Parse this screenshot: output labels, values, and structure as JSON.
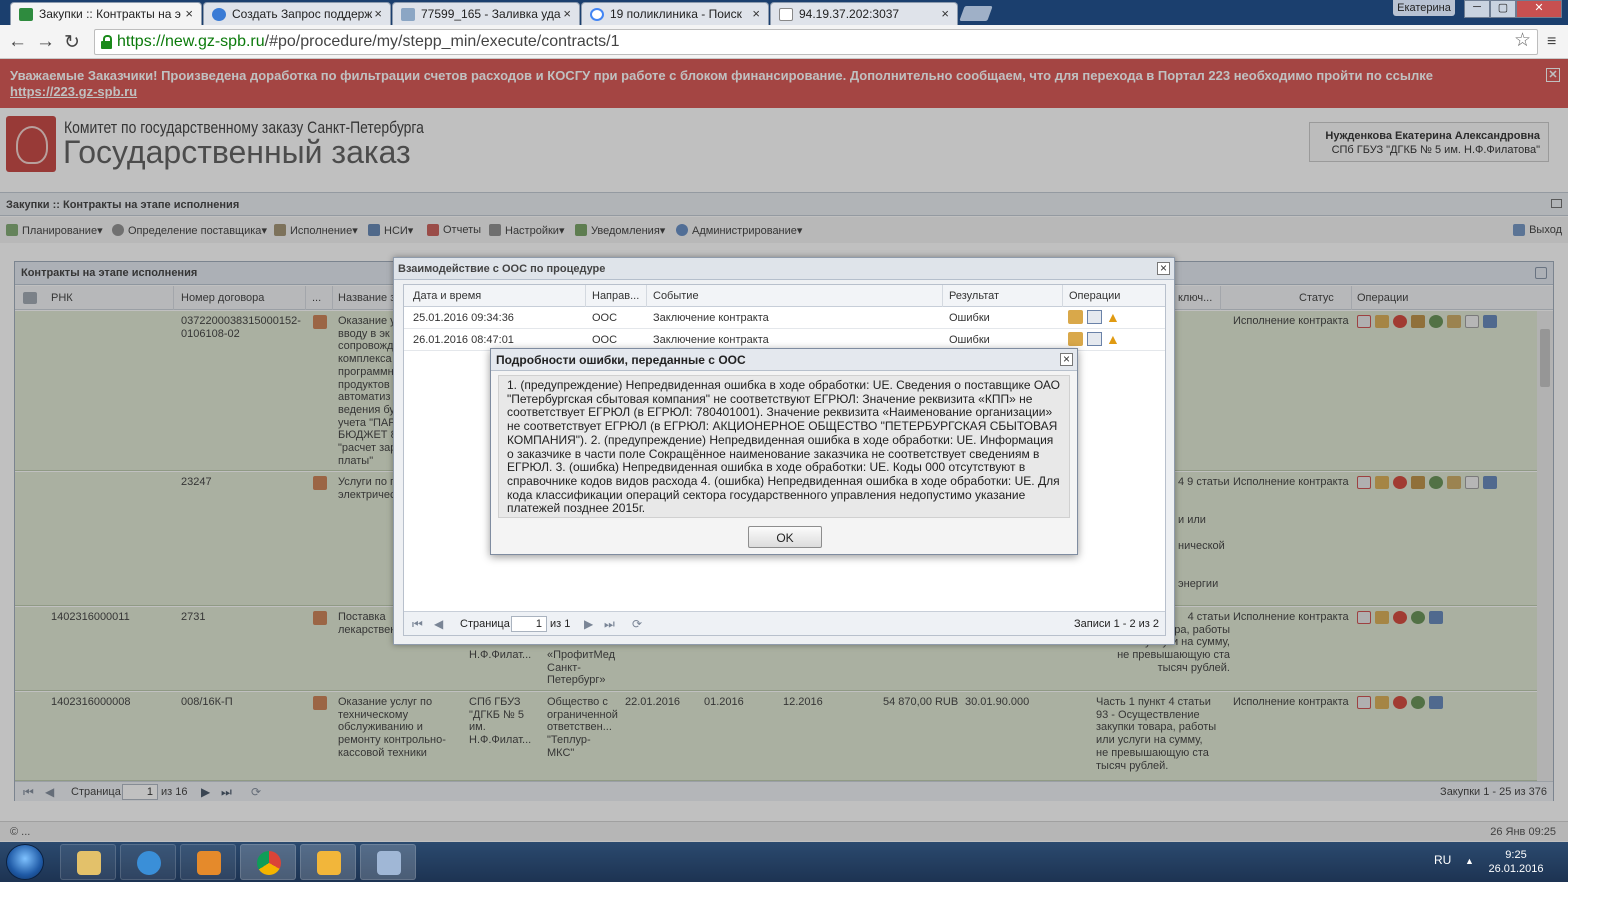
{
  "browser": {
    "tabs": [
      {
        "title": "Закупки :: Контракты на э",
        "active": true
      },
      {
        "title": "Создать Запрос поддерж"
      },
      {
        "title": "77599_165 - Заливка уда"
      },
      {
        "title": "19 поликлиника - Поиск"
      },
      {
        "title": "94.19.37.202:3037"
      }
    ],
    "profile": "Екатерина",
    "url_host": "https://new.gz-spb.ru",
    "url_path": "/#po/procedure/my/stepp_min/execute/contracts/1"
  },
  "banner": {
    "text": "Уважаемые Заказчики! Произведена доработка по фильтрации счетов расходов и КОСГУ при работе с блоком финансирование. Дополнительно сообщаем, что для перехода в Портал 223 необходимо пройти по ссылке",
    "link": "https://223.gz-spb.ru",
    "close": "✕"
  },
  "header": {
    "org_line1": "Комитет по государственному заказу Санкт-Петербурга",
    "org_line2": "Государственный заказ",
    "user_name": "Нужденкова Екатерина Александровна",
    "user_org": "СПб ГБУЗ \"ДГКБ № 5 им. Н.Ф.Филатова\""
  },
  "breadcrumb": "Закупки :: Контракты на этапе исполнения",
  "menu": {
    "items": [
      "Планирование",
      "Определение поставщика",
      "Исполнение",
      "НСИ",
      "Отчеты",
      "Настройки",
      "Уведомления",
      "Администрирование"
    ],
    "exit": "Выход"
  },
  "grid": {
    "title": "Контракты на этапе исполнения",
    "columns": {
      "rnk": "РНК",
      "number": "Номер договора",
      "dots": "...",
      "name": "Название з",
      "basis": "ключ...",
      "status": "Статус",
      "ops": "Операции"
    },
    "rows": [
      {
        "rnk": "",
        "number": "0372200038315000152-0106108-02",
        "name": "Оказание у\nвводу в эк\nсопровожд\nкомплекса\nпрограммн\nпродуктов\nавтоматиз\nведения бу\nучета \"ПАР\nБЮДЖЕТ 8\n\"расчет зар\nплаты\"",
        "basis": "",
        "status": "Исполнение контракта"
      },
      {
        "rnk": "",
        "number": "23247",
        "name": "Услуги по п\nэлектричес",
        "basis": "4 9 статьи\n\n\nи или\n\nнической\n\n\nэнергии",
        "status": "Исполнение контракта"
      },
      {
        "rnk": "1402316000011",
        "number": "2731",
        "name": "Поставка\nлекарствен",
        "customer": "Н.Ф.Филат...",
        "supplier": "«ПрофитМед\nСанкт-\nПетербург»",
        "basis": "4 статьи\nкупки товара, работы\nили услуги на сумму,\nне превышающую ста\nтысяч рублей.",
        "status": "Исполнение контракта"
      },
      {
        "rnk": "1402316000008",
        "number": "008/16К-П",
        "name": "Оказание услуг по\nтехническому\nобслуживанию и\nремонту контрольно-\nкассовой техники",
        "customer": "СПб ГБУЗ\n\"ДГКБ № 5\nим.\nН.Ф.Филат...",
        "supplier": "Общество с\nограниченной\nответствен...\n\"Теплур-\nМКС\"",
        "date": "22.01.2016",
        "start": "01.2016",
        "end": "12.2016",
        "price": "54 870,00 RUB",
        "okpd": "30.01.90.000",
        "basis": "Часть 1 пункт 4 статьи\n93 - Осуществление\nзакупки товара, работы\nили услуги на сумму,\nне превышающую ста\nтысяч рублей.",
        "status": "Исполнение контракта"
      }
    ],
    "pager": {
      "page_label": "Страница",
      "page": "1",
      "of": "из 16",
      "records": "Закупки 1 - 25 из 376"
    }
  },
  "oos_dialog": {
    "title": "Взаимодействие с ООС по процедуре",
    "columns": {
      "datetime": "Дата и время",
      "direction": "Направ...",
      "event": "Событие",
      "result": "Результат",
      "ops": "Операции"
    },
    "rows": [
      {
        "datetime": "25.01.2016 09:34:36",
        "direction": "ООС",
        "event": "Заключение контракта",
        "result": "Ошибки"
      },
      {
        "datetime": "26.01.2016 08:47:01",
        "direction": "ООС",
        "event": "Заключение контракта",
        "result": "Ошибки"
      }
    ],
    "pager": {
      "page_label": "Страница",
      "page": "1",
      "of": "из 1",
      "records": "Записи 1 - 2 из 2"
    }
  },
  "error_dialog": {
    "title": "Подробности ошибки, переданные с ООС",
    "body": "1. (предупреждение) Непредвиденная ошибка в ходе обработки: UE. Сведения о поставщике ОАО \"Петербургская сбытовая компания\" не соответствуют ЕГРЮЛ: Значение реквизита «КПП» не соответствует ЕГРЮЛ (в ЕГРЮЛ: 780401001). Значение реквизита «Наименование организации» не соответствует ЕГРЮЛ (в ЕГРЮЛ: АКЦИОНЕРНОЕ ОБЩЕСТВО \"ПЕТЕРБУРГСКАЯ СБЫТОВАЯ КОМПАНИЯ\"). 2. (предупреждение) Непредвиденная ошибка в ходе обработки: UE. Информация о заказчике в части поле Сокращённое наименование заказчика не соответствует сведениям в ЕГРЮЛ. 3. (ошибка) Непредвиденная ошибка в ходе обработки: UE. Коды 000 отсутствуют в справочнике кодов видов расхода 4. (ошибка) Непредвиденная ошибка в ходе обработки: UE. Для кода классификации операций сектора государственного управления недопустимо указание платежей позднее 2015г.",
    "ok": "OK"
  },
  "footer": {
    "left": "© ...",
    "right": "26 Янв 09:25"
  },
  "taskbar": {
    "lang": "RU",
    "time": "9:25",
    "date": "26.01.2016"
  }
}
